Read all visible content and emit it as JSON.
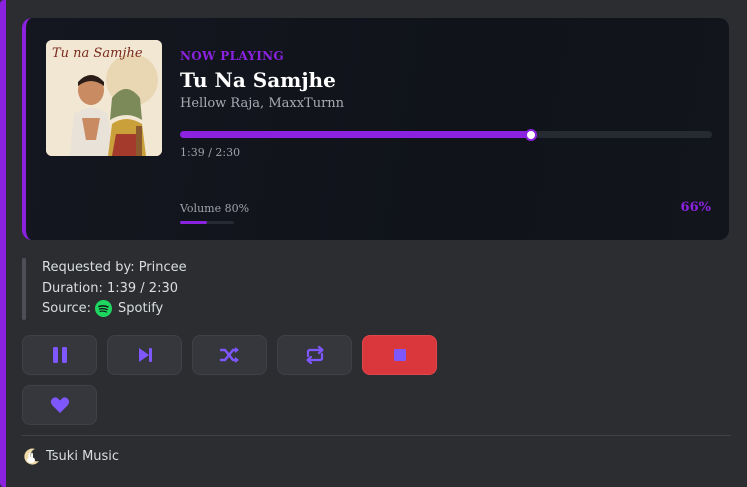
{
  "now_playing": {
    "label": "NOW PLAYING",
    "title": "Tu Na Samjhe",
    "artist": "Hellow Raja, MaxxTurnn",
    "time": "1:39 / 2:30",
    "progress_fraction": 0.66,
    "volume_label": "Volume 80%",
    "volume_fraction": 0.5,
    "progress_percent": "66%",
    "cover_text": "Tu na Samjhe"
  },
  "info": {
    "requested_by": "Requested by: Princee",
    "duration": "Duration: 1:39 / 2:30",
    "source_prefix": "Source:",
    "source_name": "Spotify"
  },
  "controls": {
    "icons": [
      "pause-icon",
      "skip-next-icon",
      "shuffle-icon",
      "repeat-icon",
      "stop-icon",
      "heart-icon"
    ]
  },
  "colors": {
    "accent": "#8b22e0",
    "button": "#36373d",
    "stop": "#da373c",
    "icon": "#7e57ff",
    "spotify": "#1ed760"
  },
  "footer": {
    "bot_name": "Tsuki Music"
  }
}
